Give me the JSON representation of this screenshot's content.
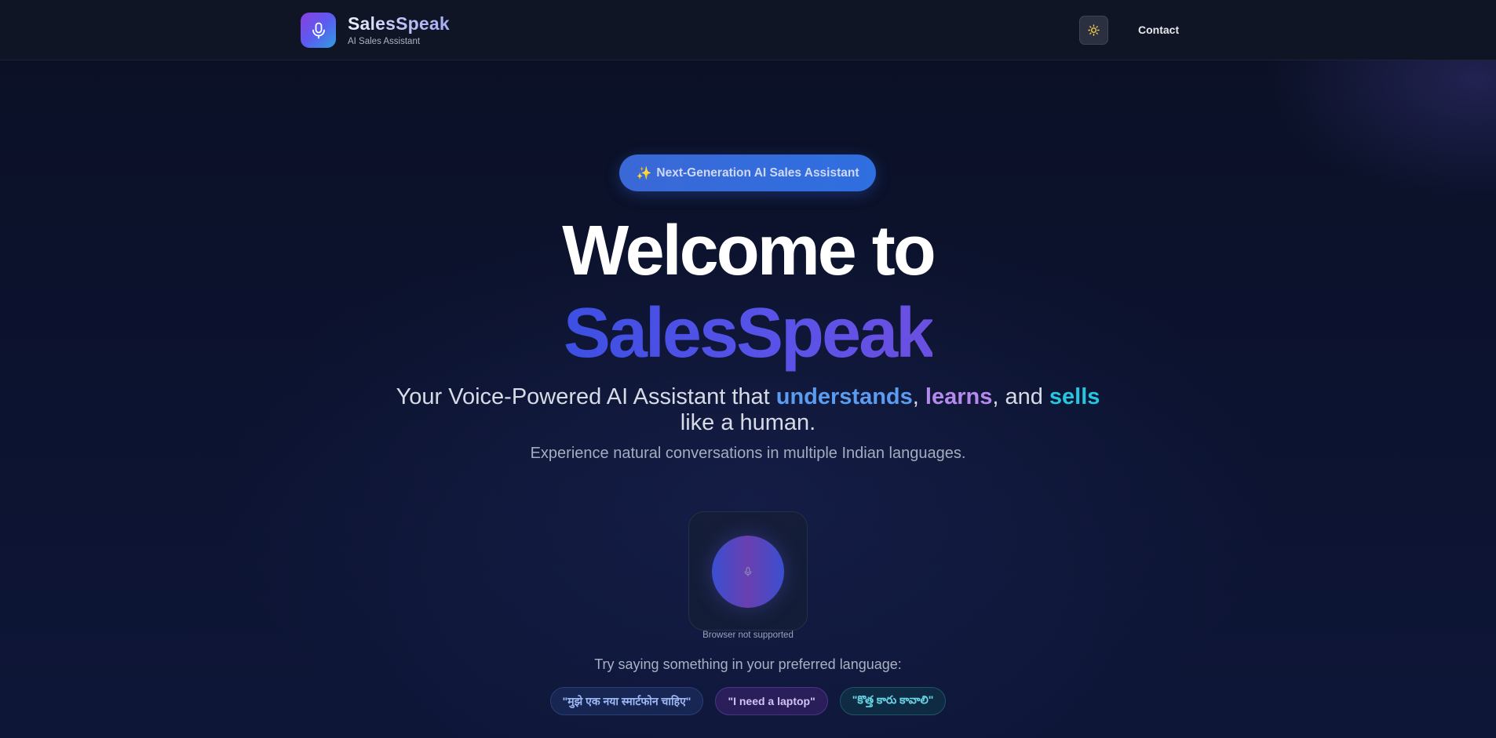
{
  "header": {
    "brand_name": "SalesSpeak",
    "brand_subtitle": "AI Sales Assistant",
    "logo_icon": "microphone-icon",
    "theme_toggle_icon": "sun-icon",
    "contact_label": "Contact"
  },
  "hero": {
    "badge_icon": "✨",
    "badge_label": "Next-Generation AI Sales Assistant",
    "title_line1": "Welcome to",
    "title_line2": "SalesSpeak",
    "tagline": {
      "prefix": "Your Voice-Powered AI Assistant that ",
      "word1": "understands",
      "sep1": ", ",
      "word2": "learns",
      "sep2": ", and ",
      "word3": "sells",
      "suffix": " like a human."
    },
    "subtitle": "Experience natural conversations in multiple Indian languages."
  },
  "voice": {
    "mic_icon": "microphone-icon",
    "status": "Browser not supported",
    "prompt": "Try saying something in your preferred language:",
    "examples": [
      "\"मुझे एक नया स्मार्टफोन चाहिए\"",
      "\"I need a laptop\"",
      "\"కొత్త కారు కావాలి\""
    ]
  },
  "colors": {
    "background": "#0b1226",
    "accent_blue": "#5b9cf0",
    "accent_purple": "#b689ee",
    "accent_cyan": "#27c6e0",
    "brand_gradient_start": "#3d4fe3",
    "brand_gradient_end": "#6b50e0"
  }
}
